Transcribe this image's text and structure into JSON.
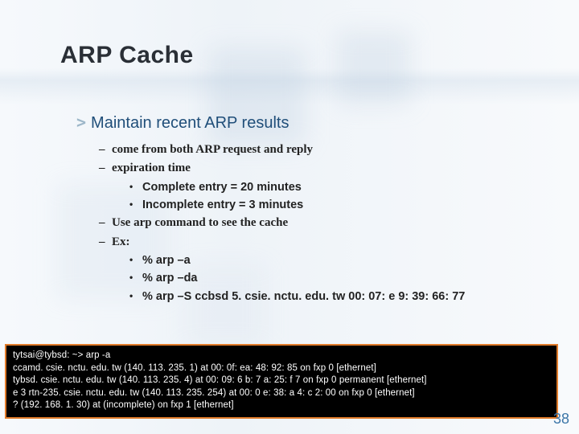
{
  "title": "ARP Cache",
  "heading": "Maintain recent ARP results",
  "bullets": {
    "b1": "come from both ARP request and reply",
    "b2": "expiration time",
    "b2a": "Complete entry = 20 minutes",
    "b2b": "Incomplete entry = 3 minutes",
    "b3": "Use arp command to see the cache",
    "b4": "Ex:",
    "b4a": "% arp –a",
    "b4b": "% arp –da",
    "b4c": "% arp –S ccbsd 5. csie. nctu. edu. tw 00: 07: e 9: 39: 66: 77"
  },
  "terminal": {
    "l1": "tytsai@tybsd: ~> arp -a",
    "l2": "ccamd. csie. nctu. edu. tw (140. 113. 235. 1) at 00: 0f: ea: 48: 92: 85 on fxp 0 [ethernet]",
    "l3": "tybsd. csie. nctu. edu. tw (140. 113. 235. 4) at 00: 09: 6 b: 7 a: 25: f 7 on fxp 0 permanent [ethernet]",
    "l4": "e 3 rtn-235. csie. nctu. edu. tw (140. 113. 235. 254) at 00: 0 e: 38: a 4: c 2: 00 on fxp 0 [ethernet]",
    "l5": "? (192. 168. 1. 30) at (incomplete) on fxp 1 [ethernet]"
  },
  "page_number": "38"
}
